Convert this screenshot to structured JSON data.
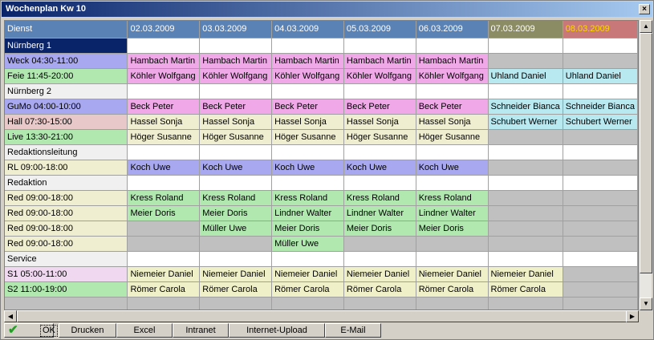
{
  "window": {
    "title": "Wochenplan Kw 10",
    "close_label": "×"
  },
  "header": {
    "dienst": "Dienst",
    "days": [
      "02.03.2009",
      "03.03.2009",
      "04.03.2009",
      "05.03.2009",
      "06.03.2009",
      "07.03.2009",
      "08.03.2009"
    ]
  },
  "rows": [
    {
      "label": "Nürnberg 1",
      "type": "section-selected",
      "cells": [
        "",
        "",
        "",
        "",
        "",
        "",
        ""
      ]
    },
    {
      "label": "Weck 04:30-11:00",
      "type": "purple",
      "cells": [
        "Hambach Martin",
        "Hambach Martin",
        "Hambach Martin",
        "Hambach Martin",
        "Hambach Martin",
        "",
        ""
      ],
      "cellColor": [
        "pink",
        "pink",
        "pink",
        "pink",
        "pink",
        "empty",
        "empty"
      ]
    },
    {
      "label": "Feie 11:45-20:00",
      "type": "green",
      "cells": [
        "Köhler Wolfgang",
        "Köhler Wolfgang",
        "Köhler Wolfgang",
        "Köhler Wolfgang",
        "Köhler Wolfgang",
        "Uhland Daniel",
        "Uhland Daniel"
      ],
      "cellColor": [
        "pink",
        "pink",
        "pink",
        "pink",
        "pink",
        "cyan",
        "cyan"
      ]
    },
    {
      "label": "Nürnberg 2",
      "type": "section",
      "cells": [
        "",
        "",
        "",
        "",
        "",
        "",
        ""
      ]
    },
    {
      "label": "GuMo 04:00-10:00",
      "type": "purple",
      "cells": [
        "Beck Peter",
        "Beck Peter",
        "Beck Peter",
        "Beck Peter",
        "Beck Peter",
        "Schneider Bianca",
        "Schneider Bianca"
      ],
      "cellColor": [
        "pink",
        "pink",
        "pink",
        "pink",
        "pink",
        "cyan",
        "cyan"
      ]
    },
    {
      "label": "Hall 07:30-15:00",
      "type": "rose",
      "cells": [
        "Hassel Sonja",
        "Hassel Sonja",
        "Hassel Sonja",
        "Hassel Sonja",
        "Hassel Sonja",
        "Schubert Werner",
        "Schubert Werner"
      ],
      "cellColor": [
        "lyellow",
        "lyellow",
        "lyellow",
        "lyellow",
        "lyellow",
        "cyan",
        "cyan"
      ]
    },
    {
      "label": "Live 13:30-21:00",
      "type": "green",
      "cells": [
        "Höger Susanne",
        "Höger Susanne",
        "Höger Susanne",
        "Höger Susanne",
        "Höger Susanne",
        "",
        ""
      ],
      "cellColor": [
        "lyellow",
        "lyellow",
        "lyellow",
        "lyellow",
        "lyellow",
        "empty",
        "empty"
      ]
    },
    {
      "label": "Redaktionsleitung",
      "type": "section",
      "cells": [
        "",
        "",
        "",
        "",
        "",
        "",
        ""
      ]
    },
    {
      "label": "RL 09:00-18:00",
      "type": "lyellow",
      "cells": [
        "Koch Uwe",
        "Koch Uwe",
        "Koch Uwe",
        "Koch Uwe",
        "Koch Uwe",
        "",
        ""
      ],
      "cellColor": [
        "purple",
        "purple",
        "purple",
        "purple",
        "purple",
        "empty",
        "empty"
      ]
    },
    {
      "label": "Redaktion",
      "type": "section",
      "cells": [
        "",
        "",
        "",
        "",
        "",
        "",
        ""
      ]
    },
    {
      "label": "Red 09:00-18:00",
      "type": "lyellow",
      "cells": [
        "Kress Roland",
        "Kress Roland",
        "Kress Roland",
        "Kress Roland",
        "Kress Roland",
        "",
        ""
      ],
      "cellColor": [
        "green",
        "green",
        "green",
        "green",
        "green",
        "empty",
        "empty"
      ]
    },
    {
      "label": "Red 09:00-18:00",
      "type": "lyellow",
      "cells": [
        "Meier Doris",
        "Meier Doris",
        "Lindner Walter",
        "Lindner Walter",
        "Lindner Walter",
        "",
        ""
      ],
      "cellColor": [
        "green",
        "green",
        "green",
        "green",
        "green",
        "empty",
        "empty"
      ]
    },
    {
      "label": "Red 09:00-18:00",
      "type": "lyellow",
      "cells": [
        "",
        "Müller Uwe",
        "Meier Doris",
        "Meier Doris",
        "Meier Doris",
        "",
        ""
      ],
      "cellColor": [
        "empty",
        "green",
        "green",
        "green",
        "green",
        "empty",
        "empty"
      ]
    },
    {
      "label": "Red 09:00-18:00",
      "type": "lyellow",
      "cells": [
        "",
        "",
        "Müller Uwe",
        "",
        "",
        "",
        ""
      ],
      "cellColor": [
        "empty",
        "empty",
        "green",
        "empty",
        "empty",
        "empty",
        "empty"
      ]
    },
    {
      "label": "Service",
      "type": "section",
      "cells": [
        "",
        "",
        "",
        "",
        "",
        "",
        ""
      ]
    },
    {
      "label": "S1 05:00-11:00",
      "type": "lav",
      "cells": [
        "Niemeier Daniel",
        "Niemeier Daniel",
        "Niemeier Daniel",
        "Niemeier Daniel",
        "Niemeier Daniel",
        "Niemeier Daniel",
        ""
      ],
      "cellColor": [
        "yellow",
        "yellow",
        "yellow",
        "yellow",
        "yellow",
        "yellow",
        "empty"
      ]
    },
    {
      "label": "S2 11:00-19:00",
      "type": "green",
      "cells": [
        "Römer Carola",
        "Römer Carola",
        "Römer Carola",
        "Römer Carola",
        "Römer Carola",
        "Römer Carola",
        ""
      ],
      "cellColor": [
        "yellow",
        "yellow",
        "yellow",
        "yellow",
        "yellow",
        "yellow",
        "empty"
      ]
    },
    {
      "label": "",
      "type": "empty",
      "cells": [
        "",
        "",
        "",
        "",
        "",
        "",
        ""
      ],
      "cellColor": [
        "empty",
        "empty",
        "empty",
        "empty",
        "empty",
        "empty",
        "empty"
      ]
    }
  ],
  "toolbar": {
    "ok": "OK",
    "drucken": "Drucken",
    "excel": "Excel",
    "intranet": "Intranet",
    "upload": "Internet-Upload",
    "email": "E-Mail"
  },
  "icons": {
    "ok": "check-icon",
    "scroll_up": "up-arrow-icon",
    "scroll_down": "down-arrow-icon",
    "scroll_left": "left-arrow-icon",
    "scroll_right": "right-arrow-icon"
  }
}
